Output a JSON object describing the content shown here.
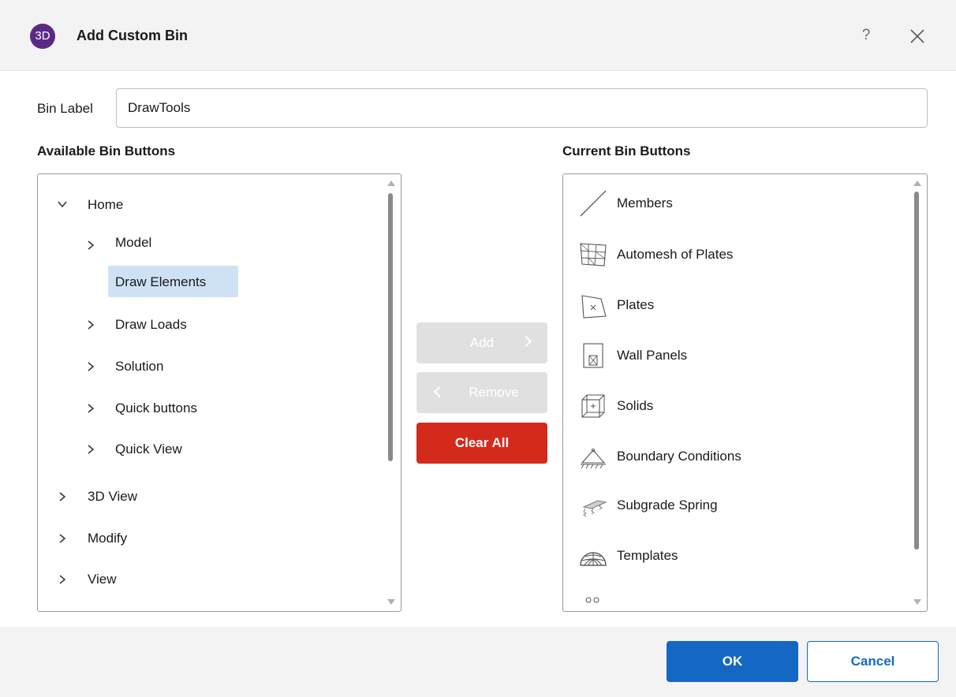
{
  "dialog": {
    "title": "Add Custom Bin",
    "logo_text": "3D",
    "help_label": "?"
  },
  "bin_label": {
    "label": "Bin Label",
    "value": "DrawTools"
  },
  "available": {
    "header": "Available Bin Buttons",
    "tree": {
      "home": "Home",
      "model": "Model",
      "draw_elements": "Draw Elements",
      "draw_loads": "Draw Loads",
      "solution": "Solution",
      "quick_buttons": "Quick buttons",
      "quick_view": "Quick View",
      "view_3d": "3D View",
      "modify": "Modify",
      "view": "View"
    },
    "selected": "Draw Elements"
  },
  "actions": {
    "add": "Add",
    "remove": "Remove",
    "clear_all": "Clear All",
    "clear_all_color": "#d42a1c"
  },
  "current": {
    "header": "Current Bin Buttons",
    "items": [
      {
        "label": "Members",
        "icon": "member-line-icon"
      },
      {
        "label": "Automesh of Plates",
        "icon": "automesh-icon"
      },
      {
        "label": "Plates",
        "icon": "plate-icon"
      },
      {
        "label": "Wall Panels",
        "icon": "wall-panel-icon"
      },
      {
        "label": "Solids",
        "icon": "solid-cube-icon"
      },
      {
        "label": "Boundary Conditions",
        "icon": "boundary-support-icon"
      },
      {
        "label": "Subgrade Spring",
        "icon": "subgrade-spring-icon"
      },
      {
        "label": "Templates",
        "icon": "template-dome-icon"
      }
    ]
  },
  "footer": {
    "ok": "OK",
    "cancel": "Cancel",
    "accent": "#1468c4"
  }
}
